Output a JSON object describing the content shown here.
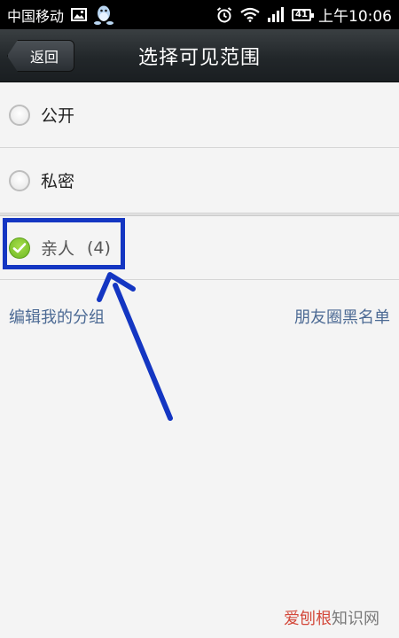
{
  "status_bar": {
    "carrier": "中国移动",
    "battery": "41",
    "time": "上午10:06"
  },
  "header": {
    "back_label": "返回",
    "title": "选择可见范围"
  },
  "options": [
    {
      "label": "公开",
      "checked": false
    },
    {
      "label": "私密",
      "checked": false
    },
    {
      "label": "亲人",
      "count": "(4)",
      "checked": true
    }
  ],
  "links": {
    "edit_groups": "编辑我的分组",
    "blacklist": "朋友圈黑名单"
  },
  "watermark": {
    "accent": "爱刨根",
    "rest": "知识网"
  },
  "colors": {
    "annotation": "#1436c2",
    "check": "#7cc531",
    "link": "#4c6a94"
  }
}
